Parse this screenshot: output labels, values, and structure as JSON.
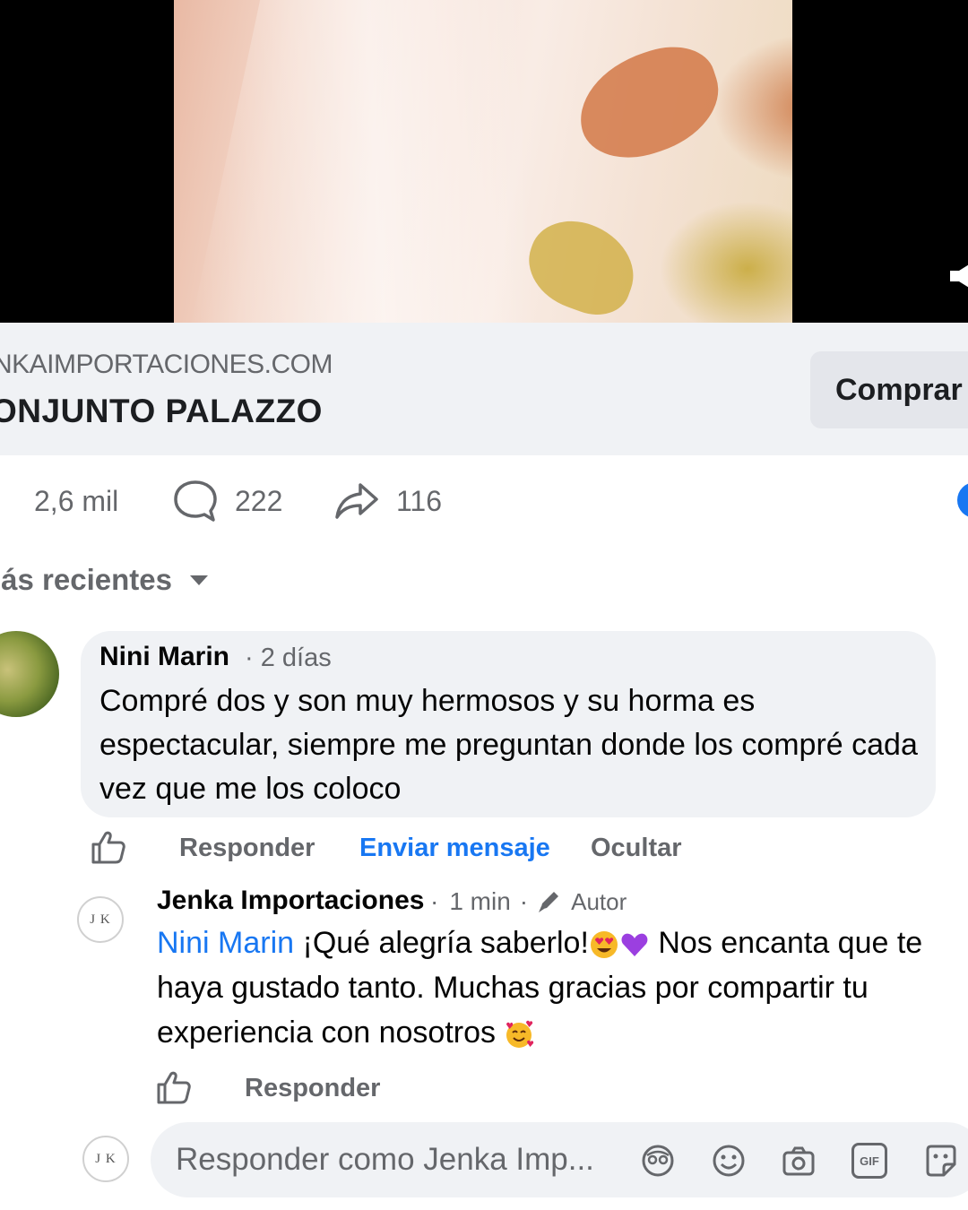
{
  "link_preview": {
    "domain": "NKAIMPORTACIONES.COM",
    "title": "ONJUNTO PALAZZO",
    "buy_label": "Comprar"
  },
  "stats": {
    "reactions": "2,6 mil",
    "comments": "222",
    "shares": "116"
  },
  "sort_label": "lás recientes",
  "comment": {
    "author": "Nini Marin",
    "time": "2 días",
    "text": "Compré dos y son muy hermosos y su horma es espectacular, siempre me preguntan donde los compré cada vez que me los coloco",
    "actions": {
      "reply": "Responder",
      "message": "Enviar mensaje",
      "hide": "Ocultar"
    }
  },
  "reply": {
    "author": "Jenka Importaciones",
    "time": "1 min",
    "badge": "Autor",
    "mention": "Nini Marin",
    "text_part1": " ¡Qué alegría saberlo!",
    "text_part2": " Nos encanta que te haya gustado tanto. Muchas gracias por compartir tu experiencia con nosotros ",
    "action_reply": "Responder",
    "avatar_initials": "J K"
  },
  "composer": {
    "placeholder": "Responder como Jenka Imp...",
    "avatar_initials": "J K",
    "gif_label": "GIF"
  },
  "icons": [
    "volume-icon",
    "like-icon",
    "comment-icon",
    "share-icon",
    "caret-down-icon",
    "pencil-icon",
    "heart-eyes-emoji",
    "purple-heart-emoji",
    "smiling-hearts-emoji",
    "avatar-icon",
    "smiley-icon",
    "camera-icon",
    "gif-icon",
    "sticker-icon"
  ],
  "colors": {
    "accent": "#1877f2",
    "secondary_text": "#65676b",
    "bubble_bg": "#f0f2f5"
  }
}
